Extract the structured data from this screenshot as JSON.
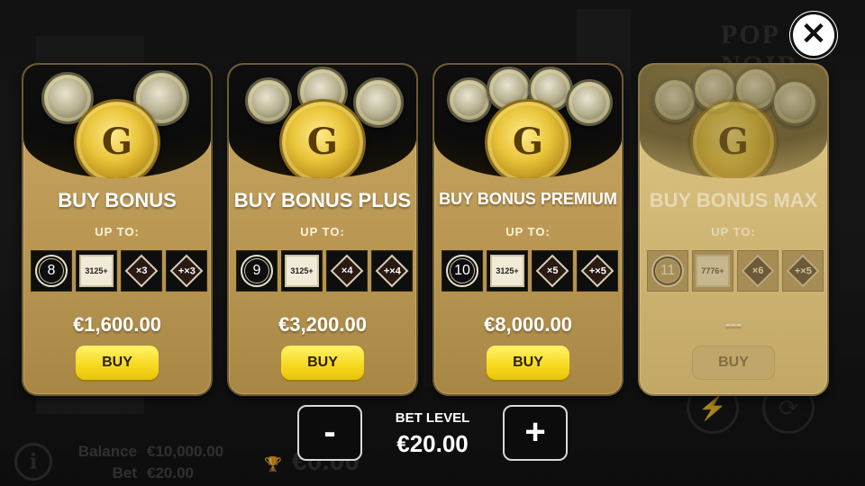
{
  "background": {
    "logo_text": "POP\nNOIR",
    "balance_label": "Balance",
    "balance_value": "€10,000.00",
    "bet_label": "Bet",
    "bet_value": "€20.00",
    "win_value": "€0.00"
  },
  "close_label": "✕",
  "cards": [
    {
      "title": "BUY BONUS",
      "upto": "UP TO:",
      "features": {
        "ring": "8",
        "tile": "3125+",
        "diamond1": "×3",
        "diamond2": "+×3"
      },
      "price": "€1,600.00",
      "buy_label": "BUY"
    },
    {
      "title": "BUY BONUS PLUS",
      "upto": "UP TO:",
      "features": {
        "ring": "9",
        "tile": "3125+",
        "diamond1": "×4",
        "diamond2": "+×4"
      },
      "price": "€3,200.00",
      "buy_label": "BUY"
    },
    {
      "title": "BUY BONUS PREMIUM",
      "upto": "UP TO:",
      "features": {
        "ring": "10",
        "tile": "3125+",
        "diamond1": "×5",
        "diamond2": "+×5"
      },
      "price": "€8,000.00",
      "buy_label": "BUY"
    },
    {
      "title": "BUY BONUS MAX",
      "upto": "UP TO:",
      "features": {
        "ring": "11",
        "tile": "7776+",
        "diamond1": "×6",
        "diamond2": "+×5"
      },
      "price": "---",
      "buy_label": "BUY"
    }
  ],
  "bet": {
    "minus_label": "-",
    "plus_label": "+",
    "level_label": "BET LEVEL",
    "level_value": "€20.00"
  },
  "icons": {
    "coin_glyph": "G",
    "trophy_glyph": "🏆",
    "info_glyph": "i",
    "lightning_glyph": "⚡",
    "autoplay_glyph": "⟳"
  }
}
